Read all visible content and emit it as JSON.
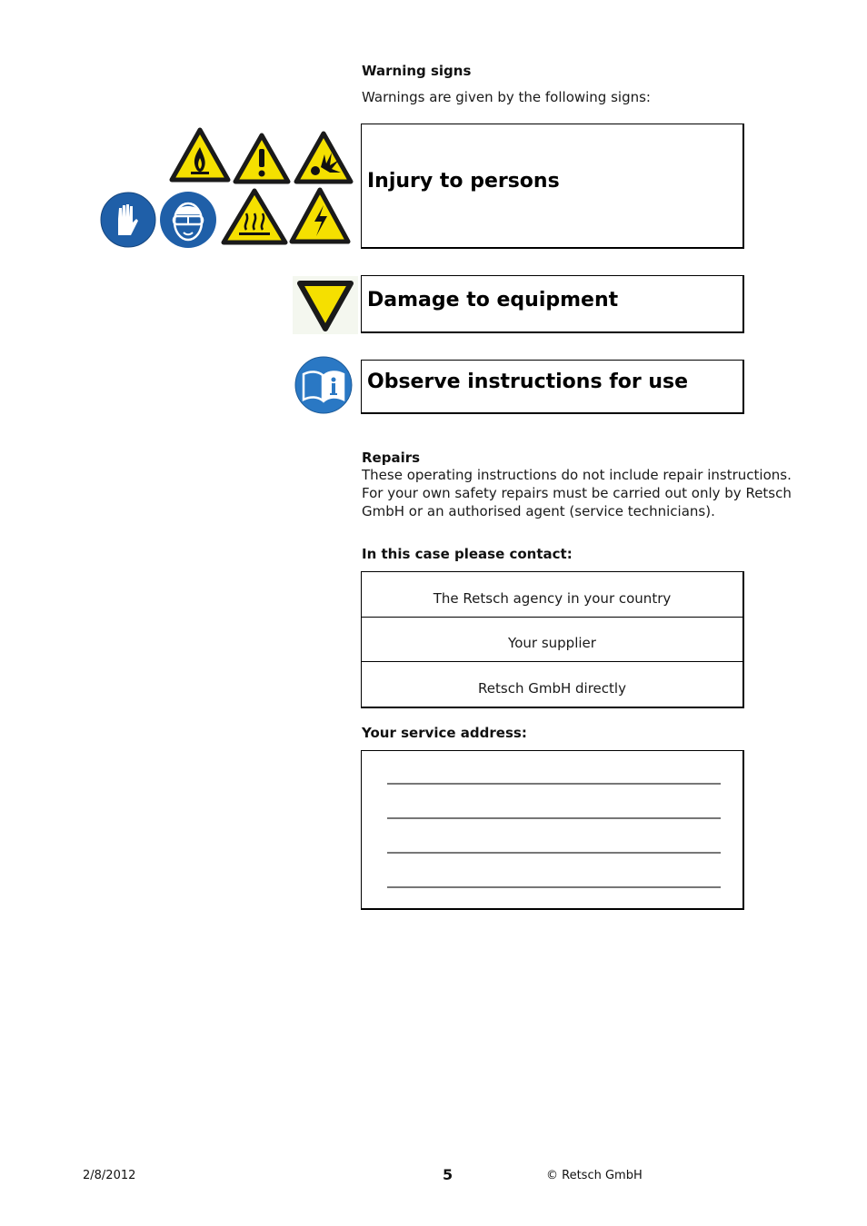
{
  "warning_signs": {
    "heading": "Warning signs",
    "intro": "Warnings are given by the following signs:",
    "icons_injury": [
      "fire-warning-icon",
      "general-warning-icon",
      "explosion-warning-icon",
      "gloves-mandatory-icon",
      "eye-protection-mandatory-icon",
      "hot-surface-warning-icon",
      "electric-shock-warning-icon"
    ],
    "boxes": [
      {
        "icon": "equipment-damage-icon",
        "label": "Injury to persons"
      },
      {
        "icon": "equipment-damage-icon",
        "label": "Damage to equipment"
      },
      {
        "icon": "read-instructions-icon",
        "label": "Observe instructions for use"
      }
    ]
  },
  "repairs": {
    "heading": "Repairs",
    "lines": [
      "These operating instructions do not include repair instructions.",
      "For your own safety repairs must be carried out only by Retsch",
      "GmbH or an authorised agent (service technicians)."
    ]
  },
  "contact": {
    "heading": "In this case please contact:",
    "rows": [
      "The Retsch agency in your country",
      "Your supplier",
      "Retsch GmbH directly"
    ]
  },
  "service_address": {
    "heading": "Your service address:",
    "blank_lines": 4
  },
  "footer": {
    "date": "2/8/2012",
    "page_number": "5",
    "copyright": "© Retsch GmbH"
  },
  "colors": {
    "warning_yellow": "#f5e000",
    "mandatory_blue": "#1f5fa8",
    "info_blue": "#2a78c4"
  }
}
